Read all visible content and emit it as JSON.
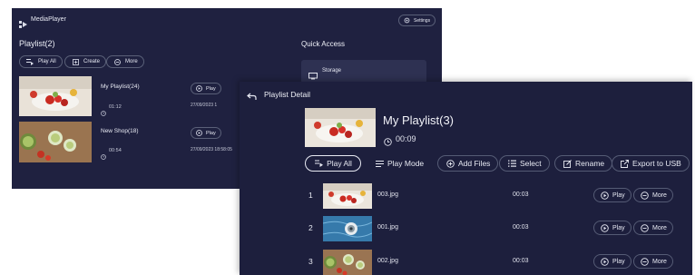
{
  "back_window": {
    "app_title": "MediaPlayer",
    "settings_label": "Settings",
    "section_title": "Playlist(2)",
    "quick_access_title": "Quick Access",
    "storage_label": "Storage",
    "actions": {
      "play_all": "Play All",
      "create": "Create",
      "more": "More"
    },
    "playlists": [
      {
        "name": "My Playlist(24)",
        "duration": "01:12",
        "play": "Play",
        "date": "27/09/2023 1"
      },
      {
        "name": "New Shop(18)",
        "duration": "00:54",
        "play": "Play",
        "date": "27/09/2023 18:58:05"
      }
    ]
  },
  "front_window": {
    "header_title": "Playlist Detail",
    "playlist_name": "My Playlist(3)",
    "playlist_duration": "00:09",
    "toolbar": {
      "play_all": "Play All",
      "play_mode": "Play Mode",
      "add_files": "Add Files",
      "select": "Select",
      "rename": "Rename",
      "export": "Export to USB"
    },
    "items": [
      {
        "index": "1",
        "file": "003.jpg",
        "duration": "00:03",
        "play": "Play",
        "more": "More"
      },
      {
        "index": "2",
        "file": "001.jpg",
        "duration": "00:03",
        "play": "Play",
        "more": "More"
      },
      {
        "index": "3",
        "file": "002.jpg",
        "duration": "00:03",
        "play": "Play",
        "more": "More"
      }
    ]
  }
}
